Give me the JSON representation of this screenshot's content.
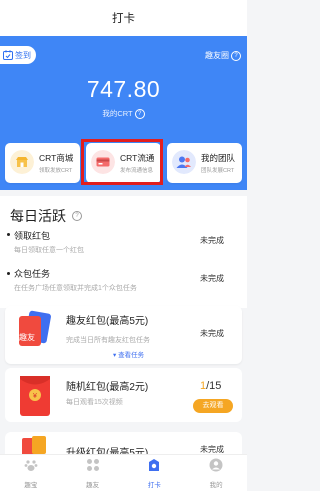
{
  "header": {
    "title": "打卡"
  },
  "hero": {
    "checkin_label": "签到",
    "friend_circle_label": "趣友圈",
    "balance": "747.80",
    "my_crt_label": "我的CRT"
  },
  "cards": [
    {
      "title": "CRT商城",
      "subtitle": "领取发放CRT"
    },
    {
      "title": "CRT流通",
      "subtitle": "发布流通信息"
    },
    {
      "title": "我的团队",
      "subtitle": "团队发展CRT"
    }
  ],
  "daily": {
    "title": "每日活跃",
    "tasks": [
      {
        "title": "领取红包",
        "desc": "每日领取任意一个红包",
        "status": "未完成"
      },
      {
        "title": "众包任务",
        "desc": "在任务广场任意领取并完成1个众包任务",
        "status": "未完成"
      }
    ]
  },
  "redpackets": [
    {
      "badge": "趣友",
      "title": "趣友红包(最高5元)",
      "desc": "完成当日所有趣友红包任务",
      "status": "未完成",
      "link": "查看任务"
    },
    {
      "title": "随机红包(最高2元)",
      "desc": "每日观看15次视频",
      "progress_done": "1",
      "progress_total": "/15",
      "button": "去观看"
    },
    {
      "title": "升级红包(最高5元)",
      "status": "未完成"
    }
  ],
  "tabbar": [
    {
      "label": "趣宝"
    },
    {
      "label": "趣友"
    },
    {
      "label": "打卡"
    },
    {
      "label": "我的"
    }
  ],
  "colors": {
    "brand_blue": "#3f86f6",
    "highlight_red": "#e21e1e",
    "accent_orange": "#f5a623"
  }
}
